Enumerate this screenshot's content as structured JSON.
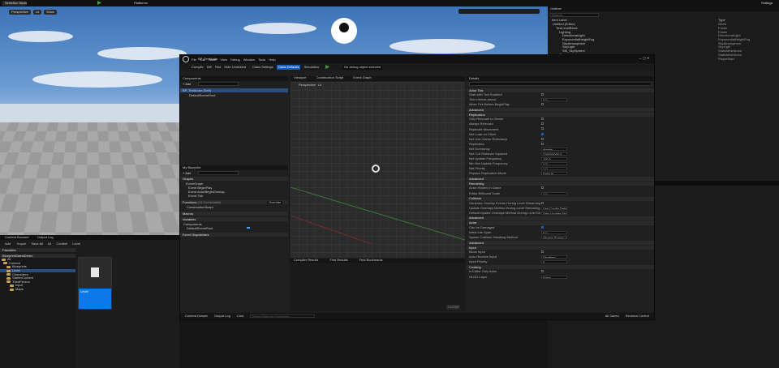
{
  "viewport": {
    "top_bar": {
      "mode": "Selection Mode",
      "perspective": "Perspective",
      "lit": "Lit",
      "show": "Show",
      "platforms": "Platforms"
    },
    "settings": "Settings"
  },
  "outliner": {
    "title": "Outliner",
    "search_placeholder": "Search...",
    "col_label": "Item Label",
    "col_type": "Type",
    "items": [
      {
        "label": "Untitled (Editor)",
        "type": "World"
      },
      {
        "label": "TestLevelBlock",
        "type": "Folder"
      },
      {
        "label": "Lighting",
        "type": "Folder"
      },
      {
        "label": "DirectionalLight",
        "type": "DirectionalLight"
      },
      {
        "label": "ExponentialHeightFog",
        "type": "ExponentialHeightFog"
      },
      {
        "label": "SkyAtmosphere",
        "type": "SkyAtmosphere"
      },
      {
        "label": "SkyLight",
        "type": "SkyLight"
      },
      {
        "label": "SM_SkySphere",
        "type": "StaticMeshActor"
      },
      {
        "label": "Floor",
        "type": "StaticMeshActor"
      },
      {
        "label": "PlayerStart",
        "type": "PlayerStart"
      }
    ]
  },
  "bp": {
    "tab": "BP_TestActor",
    "menu": [
      "File",
      "Edit",
      "Asset",
      "View",
      "Debug",
      "Window",
      "Tools",
      "Help"
    ],
    "toolbar": {
      "compile": "Compile",
      "diff": "Diff",
      "find": "Find",
      "hide_unrelated": "Hide Unrelated",
      "class_settings": "Class Settings",
      "class_defaults": "Class Defaults",
      "simulation": "Simulation",
      "debug_filter": "No debug object selected"
    },
    "components": {
      "title": "Components",
      "add": "+ Add",
      "search": "Search",
      "root": "BP_TestActor (Self)",
      "child": "DefaultSceneRoot"
    },
    "mybp": {
      "title": "My Blueprint",
      "add": "+ Add",
      "search": "Search",
      "graphs_label": "Graphs",
      "event_graph": "EventGraph",
      "events": [
        "Event BeginPlay",
        "Event ActorBeginOverlap",
        "Event Tick"
      ],
      "functions_label": "Functions",
      "functions_count": "(19 Overridable)",
      "override": "Override",
      "construction": "ConstructionScript",
      "macros": "Macros",
      "variables": "Variables",
      "components_cat": "Components",
      "default_root": "DefaultSceneRoot",
      "dispatchers": "Event Dispatchers"
    },
    "tabs": {
      "viewport": "Viewport",
      "construction": "Construction Script",
      "event_graph": "Event Graph"
    },
    "view_labels": {
      "persp": "Perspective",
      "lit": "Lit"
    },
    "bottom_tabs": {
      "compiler": "Compiler Results",
      "find": "Find Results",
      "bookmarks": "Find Bookmarks"
    },
    "clear": "CLEAR",
    "details": {
      "title": "Details",
      "search": "Search",
      "sections": [
        {
          "name": "Actor Tick",
          "rows": [
            [
              "Start with Tick Enabled",
              "check"
            ],
            [
              "Tick Interval (secs)",
              "0.0"
            ],
            [
              "Allow Tick Before BeginPlay",
              "check"
            ]
          ]
        },
        {
          "name": "Advanced",
          "rows": []
        },
        {
          "name": "Replication",
          "rows": [
            [
              "Only Relevant to Owner",
              "check"
            ],
            [
              "Always Relevant",
              "check"
            ],
            [
              "Replicate Movement",
              "check"
            ],
            [
              "Net Load on Client",
              "checkon"
            ],
            [
              "Net Use Owner Relevancy",
              "check"
            ],
            [
              "Replicates",
              "check"
            ],
            [
              "Net Dormancy",
              "Awake"
            ],
            [
              "Net Cull Distance Squared",
              "225000000.0"
            ],
            [
              "Net Update Frequency",
              "100.0"
            ],
            [
              "Min Net Update Frequency",
              "2.0"
            ],
            [
              "Net Priority",
              "1.0"
            ],
            [
              "Physics Replication Mode",
              "Default"
            ]
          ]
        },
        {
          "name": "Advanced",
          "rows": []
        },
        {
          "name": "Rendering",
          "rows": [
            [
              "Actor Hidden In Game",
              "check"
            ],
            [
              "Editor Billboard Scale",
              "1.0"
            ]
          ]
        },
        {
          "name": "Collision",
          "rows": [
            [
              "Generate Overlap Events During Level Streaming",
              "check"
            ],
            [
              "Update Overlaps Method During Level Streaming",
              "Use Config Default"
            ],
            [
              "Default Update Overlaps Method During Level Streaming",
              "Only Update Movable"
            ]
          ]
        },
        {
          "name": "Advanced",
          "rows": []
        },
        {
          "name": "Actor",
          "rows": [
            [
              "Can be Damaged",
              "checkon"
            ],
            [
              "Initial Life Span",
              "0.0"
            ],
            [
              "Spawn Collision Handling Method",
              "Always Spawn, Ignore Collisions"
            ]
          ]
        },
        {
          "name": "Advanced",
          "rows": []
        },
        {
          "name": "Input",
          "rows": [
            [
              "Block Input",
              "check"
            ],
            [
              "Auto Receive Input",
              "Disabled"
            ],
            [
              "Input Priority",
              "0"
            ]
          ]
        },
        {
          "name": "Cooking",
          "rows": [
            [
              "Is Editor Only Actor",
              "check"
            ],
            [
              "HLOD Layer",
              "None"
            ]
          ]
        }
      ]
    },
    "footer": {
      "drawer": "Content Drawer",
      "output": "Output Log",
      "cmd": "Cmd",
      "console_ph": "Enter Console Command",
      "saved": "All Saved",
      "revision": "Revision Control"
    }
  },
  "content": {
    "tabs": {
      "browser": "Content Browser",
      "output": "Output Log"
    },
    "toolbar": {
      "add": "Add",
      "import": "Import",
      "save_all": "Save All"
    },
    "path": [
      "All",
      "Content",
      "Level"
    ],
    "favorites": "Favorites",
    "project": "BlueprintGameDemo",
    "tree": [
      "All",
      "Content",
      "Blueprints",
      "Level",
      "Characters",
      "StarterContent",
      "ThirdPerson",
      "Input",
      "Maps"
    ],
    "asset_name": "Level"
  }
}
